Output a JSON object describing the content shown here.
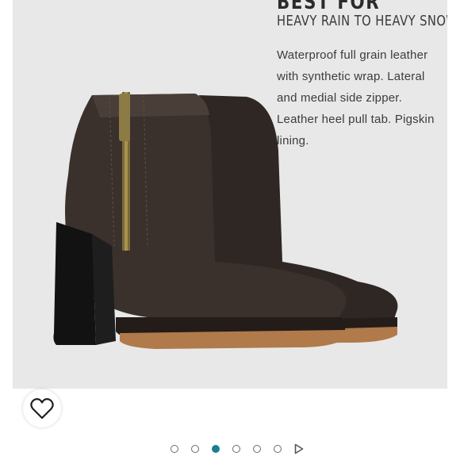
{
  "product": {
    "heading": "BEST FOR",
    "subheading": "HEAVY RAIN TO HEAVY SNOW",
    "description": "Waterproof full grain leather with synthetic wrap. Lateral and medial side zipper. Leather heel pull tab. Pigskin lining."
  },
  "gallery": {
    "slide_count": 6,
    "active_index": 3,
    "accent_color": "#1a7f8e"
  },
  "icons": {
    "favorite": "heart-outline-icon",
    "next": "play-triangle-icon"
  }
}
